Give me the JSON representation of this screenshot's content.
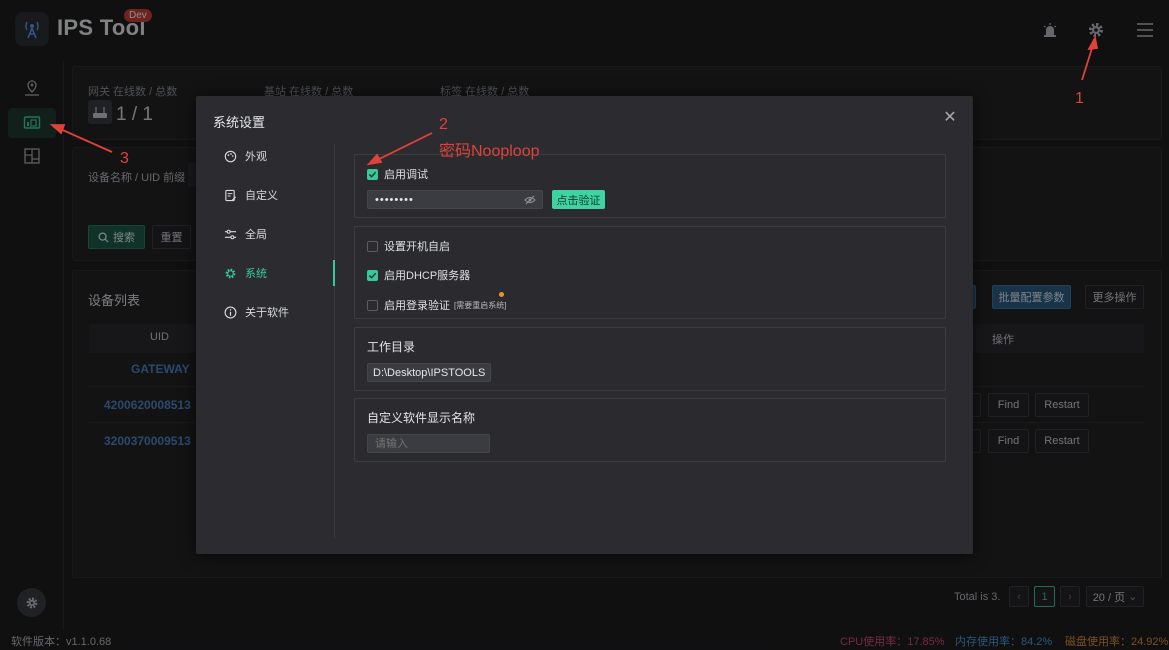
{
  "header": {
    "app_name": "IPS Tool",
    "badge": "Dev"
  },
  "stats": {
    "gateway_label": "网关 在线数 / 总数",
    "gateway_value": "1 / 1",
    "basestation_label": "基站 在线数 / 总数",
    "tag_label": "标签 在线数 / 总数"
  },
  "filter": {
    "name_prefix_label": "设备名称 / UID 前缀",
    "search": "搜索",
    "reset": "重置"
  },
  "device_list": {
    "title": "设备列表",
    "batch_config": "批量配置参数",
    "more_actions": "更多操作",
    "col_uid": "UID",
    "col_actions": "操作",
    "rows": [
      {
        "uid": "GATEWAY"
      },
      {
        "uid": "4200620008513",
        "find": "Find",
        "restart": "Restart"
      },
      {
        "uid": "3200370009513",
        "find": "Find",
        "restart": "Restart"
      }
    ],
    "pagination": {
      "total": "Total is 3.",
      "page": "1",
      "size": "20 / 页"
    }
  },
  "footer": {
    "version": "软件版本：v1.1.0.68",
    "cpu": "CPU使用率：17.85%",
    "mem": "内存使用率：84.2%",
    "disk": "磁盘使用率：24.92%"
  },
  "modal": {
    "title": "系统设置",
    "nav": [
      "外观",
      "自定义",
      "全局",
      "系统",
      "关于软件"
    ],
    "debug_label": "启用调试",
    "password_value": "••••••••",
    "verify_button": "点击验证",
    "autostart_label": "设置开机自启",
    "dhcp_label": "启用DHCP服务器",
    "login_label": "启用登录验证",
    "login_note": "[需要重启系统]",
    "workdir_title": "工作目录",
    "workdir_value": "D:\\Desktop\\IPSTOOLS",
    "custom_name_title": "自定义软件显示名称",
    "custom_name_placeholder": "请输入"
  },
  "annotations": {
    "a1": "1",
    "a2": "2",
    "a2_text": "密码Nooploop",
    "a3": "3"
  },
  "colors": {
    "accent": "#37c99a",
    "annotation": "#e0413a",
    "cpu": "#d84d7b",
    "mem": "#4f9ee0",
    "disk": "#e0923a"
  }
}
